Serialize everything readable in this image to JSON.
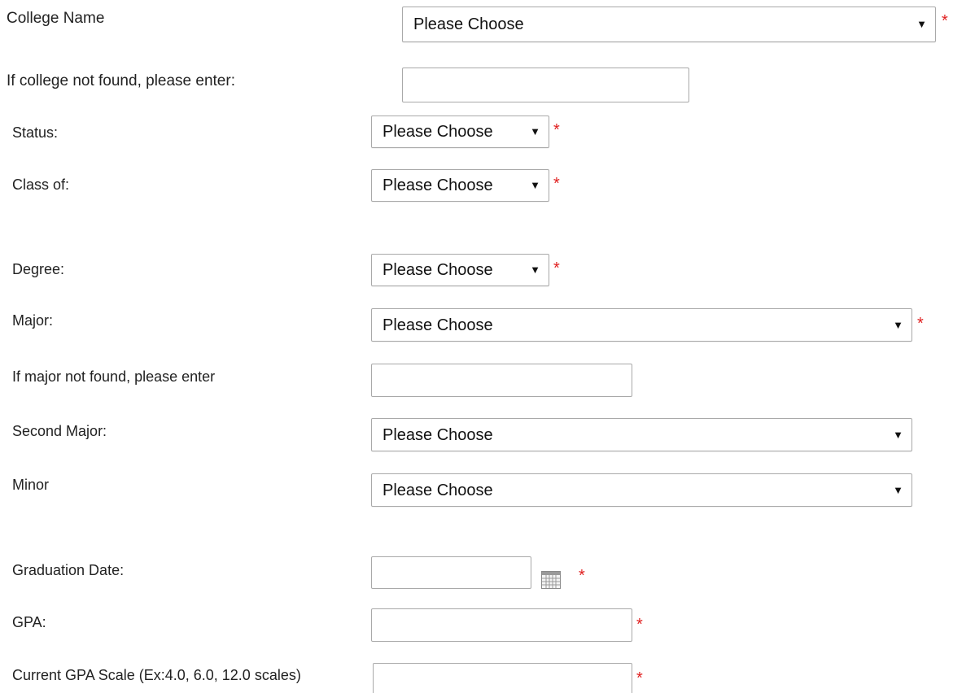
{
  "form": {
    "college_name": {
      "label": "College Name",
      "value": "Please Choose",
      "required_mark": "*"
    },
    "college_not_found": {
      "label": "If college not found, please enter:",
      "value": ""
    },
    "status": {
      "label": "Status:",
      "value": "Please Choose",
      "required_mark": "*"
    },
    "class_of": {
      "label": "Class of:",
      "value": "Please Choose",
      "required_mark": "*"
    },
    "degree": {
      "label": "Degree:",
      "value": "Please Choose",
      "required_mark": "*"
    },
    "major": {
      "label": "Major:",
      "value": "Please Choose",
      "required_mark": "*"
    },
    "major_not_found": {
      "label": "If major not found, please enter",
      "value": ""
    },
    "second_major": {
      "label": "Second Major:",
      "value": "Please Choose"
    },
    "minor": {
      "label": "Minor",
      "value": "Please Choose"
    },
    "graduation_date": {
      "label": "Graduation Date:",
      "value": "",
      "required_mark": "*",
      "icon": "calendar-icon"
    },
    "gpa": {
      "label": "GPA:",
      "value": "",
      "required_mark": "*"
    },
    "gpa_scale": {
      "label": "Current GPA Scale (Ex:4.0, 6.0, 12.0 scales)",
      "value": "",
      "required_mark": "*"
    }
  },
  "icons": {
    "dropdown": "chevron-down-icon",
    "calendar": "calendar-icon"
  },
  "colors": {
    "required": "#e02020",
    "border": "#a9a9a9",
    "text": "#222222"
  }
}
